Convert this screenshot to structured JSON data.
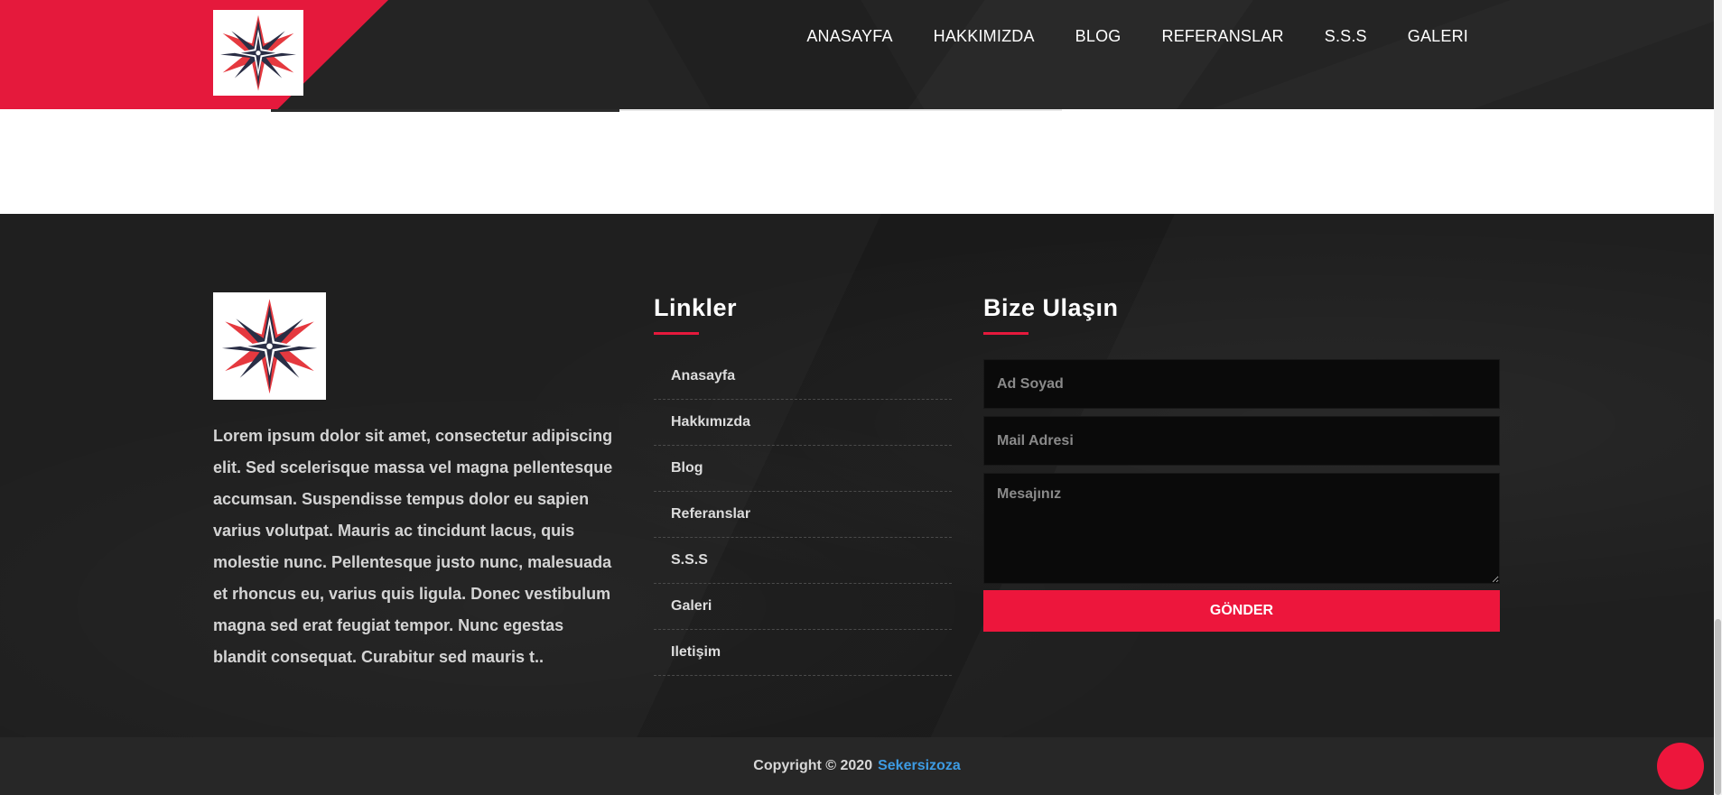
{
  "header": {
    "logo_icon": "star-compass-icon",
    "nav": [
      "ANASAYFA",
      "HAKKIMIZDA",
      "BLOG",
      "REFERANSLAR",
      "S.S.S",
      "GALERI"
    ]
  },
  "footer": {
    "logo_icon": "star-compass-icon",
    "about_text": "Lorem ipsum dolor sit amet, consectetur adipiscing elit. Sed scelerisque massa vel magna pellentesque accumsan. Suspendisse tempus dolor eu sapien varius volutpat. Mauris ac tincidunt lacus, quis molestie nunc. Pellentesque justo nunc, malesuada et rhoncus eu, varius quis ligula. Donec vestibulum magna sed erat feugiat tempor. Nunc egestas blandit consequat. Curabitur sed mauris t..",
    "links_title": "Linkler",
    "links": [
      "Anasayfa",
      "Hakkımızda",
      "Blog",
      "Referanslar",
      "S.S.S",
      "Galeri",
      "Iletişim"
    ],
    "contact_title": "Bize Ulaşın",
    "form": {
      "name_placeholder": "Ad Soyad",
      "mail_placeholder": "Mail Adresi",
      "message_placeholder": "Mesajınız",
      "submit_label": "GÖNDER"
    }
  },
  "copyright": {
    "text": "Copyright © 2020",
    "link": "Sekersizoza"
  },
  "colors": {
    "accent": "#e5193c",
    "dark": "#1f1f1f",
    "link": "#3d9be3"
  }
}
